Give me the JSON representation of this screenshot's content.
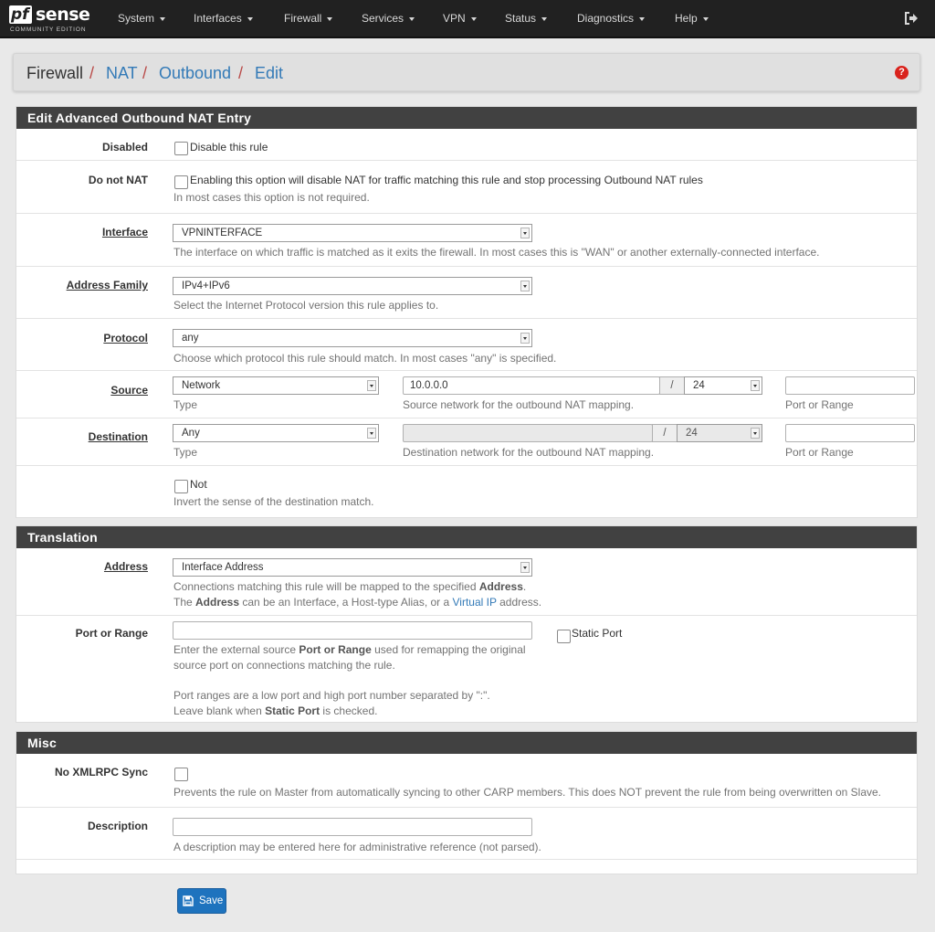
{
  "brand": {
    "logo_pf": "pf",
    "logo_sense": "sense",
    "edition": "COMMUNITY EDITION"
  },
  "nav": {
    "items": [
      {
        "label": "System"
      },
      {
        "label": "Interfaces"
      },
      {
        "label": "Firewall"
      },
      {
        "label": "Services"
      },
      {
        "label": "VPN"
      },
      {
        "label": "Status"
      },
      {
        "label": "Diagnostics"
      },
      {
        "label": "Help"
      }
    ],
    "logout_icon": "sign-out-icon"
  },
  "breadcrumb": {
    "items": [
      "Firewall",
      "NAT",
      "Outbound",
      "Edit"
    ],
    "separator": "/",
    "help_glyph": "?"
  },
  "sections": {
    "main": {
      "title": "Edit Advanced Outbound NAT Entry",
      "disabled": {
        "label": "Disabled",
        "checkbox_label": "Disable this rule",
        "checked": false
      },
      "do_not_nat": {
        "label": "Do not NAT",
        "checkbox_label": "Enabling this option will disable NAT for traffic matching this rule and stop processing Outbound NAT rules",
        "help": "In most cases this option is not required.",
        "checked": false
      },
      "interface": {
        "label": "Interface",
        "value": "VPNINTERFACE",
        "help": "The interface on which traffic is matched as it exits the firewall. In most cases this is \"WAN\" or another externally-connected interface."
      },
      "address_family": {
        "label": "Address Family",
        "value": "IPv4+IPv6",
        "help": "Select the Internet Protocol version this rule applies to."
      },
      "protocol": {
        "label": "Protocol",
        "value": "any",
        "help": "Choose which protocol this rule should match. In most cases \"any\" is specified."
      },
      "source": {
        "label": "Source",
        "type": "Network",
        "type_help": "Type",
        "network": "10.0.0.0",
        "slash": "/",
        "mask": "24",
        "network_help": "Source network for the outbound NAT mapping.",
        "port": "",
        "port_help": "Port or Range"
      },
      "destination": {
        "label": "Destination",
        "type": "Any",
        "type_help": "Type",
        "network": "",
        "slash": "/",
        "mask": "24",
        "network_help": "Destination network for the outbound NAT mapping.",
        "port": "",
        "port_help": "Port or Range"
      },
      "not": {
        "checkbox_label": "Not",
        "help": "Invert the sense of the destination match.",
        "checked": false
      }
    },
    "translation": {
      "title": "Translation",
      "address": {
        "label": "Address",
        "value": "Interface Address",
        "help1_pre": "Connections matching this rule will be mapped to the specified ",
        "help1_bold": "Address",
        "help1_post": ".",
        "help2_pre": "The ",
        "help2_bold": "Address",
        "help2_mid": " can be an Interface, a Host-type Alias, or a ",
        "help2_link": "Virtual IP",
        "help2_post": " address."
      },
      "port": {
        "label": "Port or Range",
        "value": "",
        "static_label": "Static Port",
        "static_checked": false,
        "help1_pre": "Enter the external source ",
        "help1_bold": "Port or Range",
        "help1_post": " used for remapping the original",
        "help2": "source port on connections matching the rule.",
        "help3": "Port ranges are a low port and high port number separated by \":\".",
        "help4_pre": "Leave blank when ",
        "help4_bold": "Static Port",
        "help4_post": " is checked."
      }
    },
    "misc": {
      "title": "Misc",
      "xmlrpc": {
        "label": "No XMLRPC Sync",
        "help": "Prevents the rule on Master from automatically syncing to other CARP members. This does NOT prevent the rule from being overwritten on Slave.",
        "checked": false
      },
      "description": {
        "label": "Description",
        "value": "",
        "help": "A description may be entered here for administrative reference (not parsed)."
      }
    }
  },
  "save": {
    "label": "Save",
    "icon": "save-icon"
  },
  "colors": {
    "navbar": "#212121",
    "panel_header": "#414141",
    "link": "#337ab7",
    "primary_button": "#1e73be",
    "help_icon": "#d9231d"
  }
}
